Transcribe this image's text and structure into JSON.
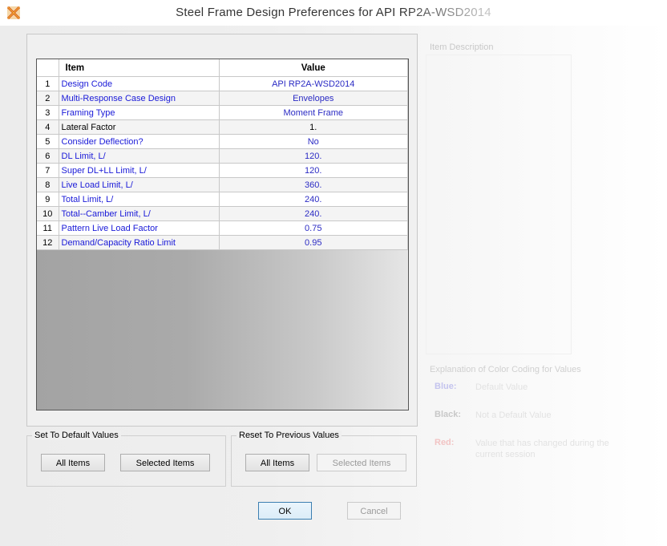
{
  "window": {
    "title": "Steel Frame Design Preferences for API RP2A-WSD2014"
  },
  "table": {
    "headers": {
      "item": "Item",
      "value": "Value"
    },
    "rows": [
      {
        "num": "1",
        "item": "Design Code",
        "value": "API RP2A-WSD2014",
        "default": true
      },
      {
        "num": "2",
        "item": "Multi-Response Case Design",
        "value": "Envelopes",
        "default": true
      },
      {
        "num": "3",
        "item": "Framing Type",
        "value": "Moment Frame",
        "default": true
      },
      {
        "num": "4",
        "item": "Lateral Factor",
        "value": "1.",
        "default": false
      },
      {
        "num": "5",
        "item": "Consider Deflection?",
        "value": "No",
        "default": true
      },
      {
        "num": "6",
        "item": "DL Limit, L/",
        "value": "120.",
        "default": true
      },
      {
        "num": "7",
        "item": "Super DL+LL Limit, L/",
        "value": "120.",
        "default": true
      },
      {
        "num": "8",
        "item": "Live Load Limit, L/",
        "value": "360.",
        "default": true
      },
      {
        "num": "9",
        "item": "Total Limit, L/",
        "value": "240.",
        "default": true
      },
      {
        "num": "10",
        "item": "Total--Camber Limit, L/",
        "value": "240.",
        "default": true
      },
      {
        "num": "11",
        "item": "Pattern Live Load Factor",
        "value": "0.75",
        "default": true
      },
      {
        "num": "12",
        "item": "Demand/Capacity Ratio Limit",
        "value": "0.95",
        "default": true
      }
    ]
  },
  "set_default": {
    "label": "Set To Default Values",
    "all": "All Items",
    "selected": "Selected Items"
  },
  "reset_previous": {
    "label": "Reset To Previous Values",
    "all": "All Items",
    "selected": "Selected Items"
  },
  "buttons": {
    "ok": "OK",
    "cancel": "Cancel"
  },
  "description": {
    "label": "Item Description"
  },
  "legend": {
    "title": "Explanation of Color Coding for Values",
    "items": [
      {
        "key": "Blue:",
        "text": "Default Value",
        "color": "#c4c4ee"
      },
      {
        "key": "Black:",
        "text": "Not a Default Value",
        "color": "#c8c8c8"
      },
      {
        "key": "Red:",
        "text": "Value that has changed during the current session",
        "color": "#f2c4c4"
      }
    ]
  },
  "colors": {
    "default_value": "#2b2bc4",
    "non_default": "#000000",
    "accent": "#3c7fb1"
  }
}
